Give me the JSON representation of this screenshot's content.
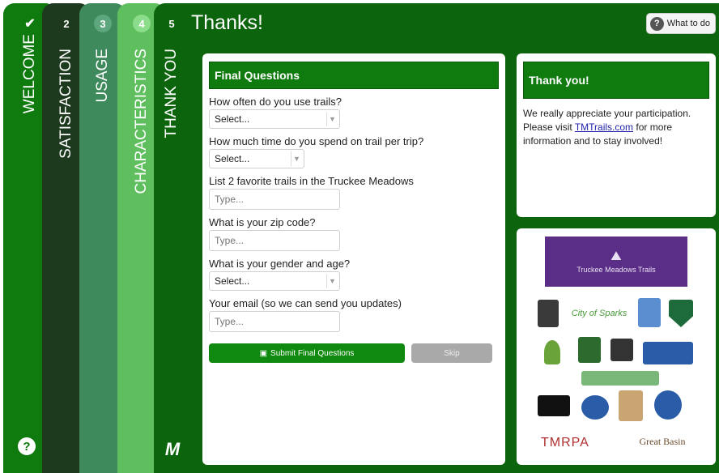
{
  "steps": [
    {
      "num": "✔",
      "label": "WELCOME"
    },
    {
      "num": "2",
      "label": "SATISFACTION"
    },
    {
      "num": "3",
      "label": "USAGE"
    },
    {
      "num": "4",
      "label": "CHARACTERISTICS"
    },
    {
      "num": "5",
      "label": "THANK YOU"
    }
  ],
  "help_glyph": "?",
  "brand_glyph": "M",
  "page_title": "Thanks!",
  "what_to_do": {
    "icon": "?",
    "label": "What to do"
  },
  "form": {
    "header": "Final Questions",
    "questions": [
      {
        "label": "How often do you use trails?",
        "type": "select",
        "value": "Select..."
      },
      {
        "label": "How much time do you spend on trail per trip?",
        "type": "select",
        "value": "Select..."
      },
      {
        "label": "List 2 favorite trails in the Truckee Meadows",
        "type": "input",
        "placeholder": "Type..."
      },
      {
        "label": "What is your zip code?",
        "type": "input",
        "placeholder": "Type..."
      },
      {
        "label": "What is your gender and age?",
        "type": "select",
        "value": "Select..."
      },
      {
        "label": "Your email (so we can send you updates)",
        "type": "input",
        "placeholder": "Type..."
      }
    ],
    "submit_label": "Submit Final Questions",
    "skip_label": "Skip"
  },
  "thanks": {
    "header": "Thank you!",
    "text_before": "We really appreciate your participation.  Please visit ",
    "link": "TMTrails.com",
    "text_after": " for more information and to stay involved!"
  },
  "sponsors": {
    "main_logo_text": "Truckee Meadows Trails",
    "small_logo_texts": [
      "City of Sparks",
      "TMRPA",
      "Great Basin"
    ]
  },
  "colors": {
    "primary": "#0f7b0f",
    "dark": "#1e3a1e",
    "usage": "#3f8a5c",
    "characteristics": "#5fbf5f"
  }
}
